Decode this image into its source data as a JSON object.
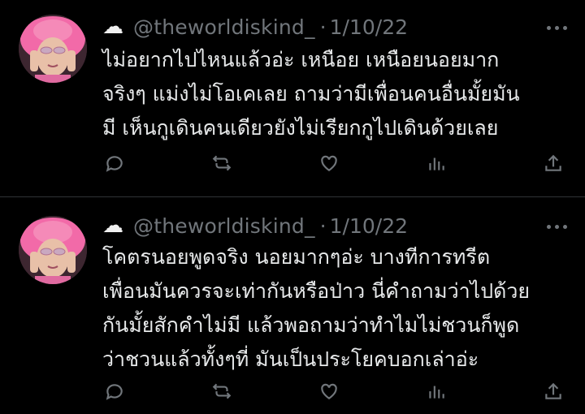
{
  "tweets": [
    {
      "avatar_icon": "profile-avatar",
      "cloud_icon": "☁",
      "handle": "@theworldiskind_",
      "separator": "·",
      "date": "1/10/22",
      "lines": [
        "ไม่อยากไปไหนแล้วอ่ะ เหนือย เหนือยนอยมาก",
        "จริงๆ แม่งไม่โอเคเลย ถามว่ามีเพื่อนคนอื่นมั้ยมัน",
        "มี เห็นกูเดินคนเดียวยังไม่เรียกกูไปเดินด้วยเลย"
      ]
    },
    {
      "avatar_icon": "profile-avatar",
      "cloud_icon": "☁",
      "handle": "@theworldiskind_",
      "separator": "·",
      "date": "1/10/22",
      "lines": [
        "โคตรนอยพูดจริง นอยมากๆอ่ะ บางทีการทรีต",
        "เพื่อนมันควรจะเท่ากันหรือป่าว นี่คำถามว่าไปด้วย",
        "กันมั้ยสักคำไม่มี แล้วพอถามว่าทำไมไม่ชวนก็พูด",
        "ว่าชวนแล้วทั้งๆที่ มันเป็นประโยคบอกเล่าอ่ะ"
      ]
    }
  ],
  "colors": {
    "background": "#000000",
    "text": "#e7e9ea",
    "muted": "#71767b",
    "divider": "#2f3336"
  }
}
